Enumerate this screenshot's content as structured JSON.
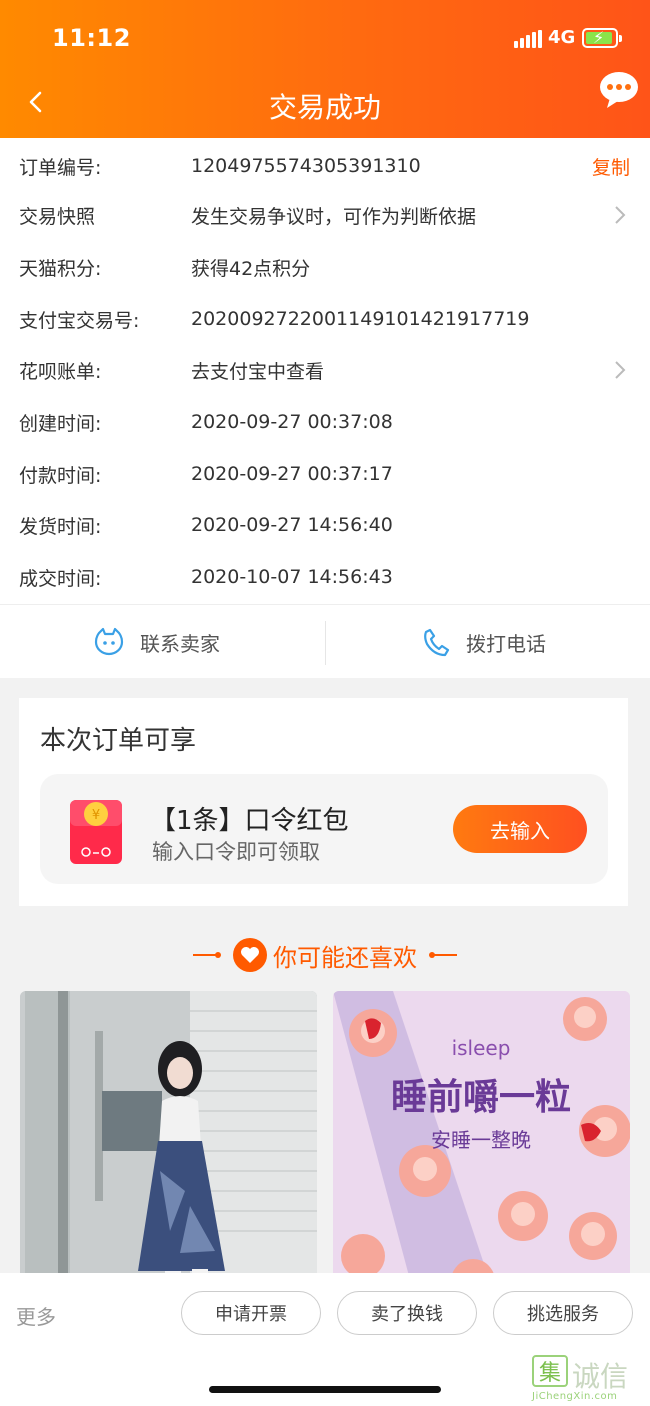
{
  "status_bar": {
    "time": "11:12",
    "network": "4G"
  },
  "header": {
    "title": "交易成功"
  },
  "order_info": [
    {
      "label": "订单编号:",
      "value": "1204975574305391310",
      "action": "复制",
      "chevron": false
    },
    {
      "label": "交易快照",
      "value": "发生交易争议时，可作为判断依据",
      "action": "",
      "chevron": true
    },
    {
      "label": "天猫积分:",
      "value": "获得42点积分",
      "action": "",
      "chevron": false
    },
    {
      "label": "支付宝交易号:",
      "value": "2020092722001149101421917719",
      "action": "",
      "chevron": false
    },
    {
      "label": "花呗账单:",
      "value": "去支付宝中查看",
      "action": "",
      "chevron": true
    },
    {
      "label": "创建时间:",
      "value": "2020-09-27 00:37:08",
      "action": "",
      "chevron": false
    },
    {
      "label": "付款时间:",
      "value": "2020-09-27 00:37:17",
      "action": "",
      "chevron": false
    },
    {
      "label": "发货时间:",
      "value": "2020-09-27 14:56:40",
      "action": "",
      "chevron": false
    },
    {
      "label": "成交时间:",
      "value": "2020-10-07 14:56:43",
      "action": "",
      "chevron": false
    }
  ],
  "contact": {
    "seller_label": "联系卖家",
    "phone_label": "拨打电话"
  },
  "benefit": {
    "title": "本次订单可享",
    "coupon_title": "【1条】口令红包",
    "coupon_subtitle": "输入口令即可领取",
    "button_label": "去输入"
  },
  "recommend": {
    "title": "你可能还喜欢"
  },
  "products": [
    {
      "name": "product-dress"
    },
    {
      "name": "product-isleep",
      "brand": "isleep",
      "headline": "睡前嚼一粒",
      "sub": "安睡一整晚"
    }
  ],
  "bottom_bar": {
    "more_label": "更多",
    "buttons": [
      "申请开票",
      "卖了换钱",
      "挑选服务"
    ]
  },
  "watermark": {
    "text": "诚信",
    "url": "JiChengXin.com"
  },
  "colors": {
    "accent": "#ff5a00",
    "header_start": "#ff8a00",
    "header_end": "#ff5418",
    "contact_icon": "#3aa0e6"
  }
}
